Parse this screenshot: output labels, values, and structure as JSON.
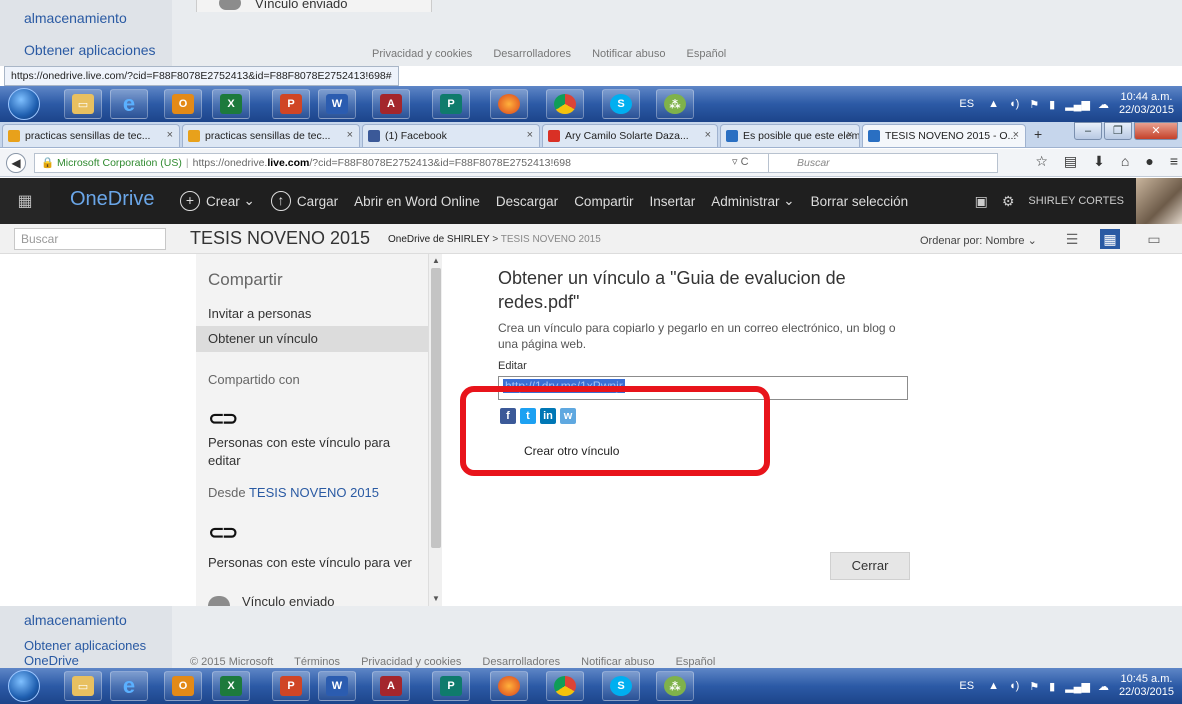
{
  "bg_top": {
    "sidebar_links": [
      "almacenamiento",
      "Obtener aplicaciones"
    ],
    "panel_item": "Vínculo enviado",
    "footer": [
      "Privacidad y cookies",
      "Desarrolladores",
      "Notificar abuso",
      "Español"
    ]
  },
  "status_url": "https://onedrive.live.com/?cid=F88F8078E2752413&id=F88F8078E2752413!698#",
  "taskbar_top": {
    "language": "ES",
    "time": "10:44 a.m.",
    "date": "22/03/2015",
    "apps": [
      "windows-explorer",
      "internet-explorer",
      "outlook",
      "excel",
      "powerpoint",
      "word",
      "access",
      "publisher",
      "firefox",
      "chrome",
      "skype",
      "network"
    ]
  },
  "browser": {
    "tabs": [
      {
        "label": "practicas sensillas de tec...",
        "color": "#e8a11b"
      },
      {
        "label": "practicas sensillas de tec...",
        "color": "#e8a11b"
      },
      {
        "label": "(1) Facebook",
        "color": "#3b5998"
      },
      {
        "label": "Ary Camilo Solarte Daza...",
        "color": "#d93025"
      },
      {
        "label": "Es posible que este elem...",
        "color": "#2a6fc2"
      },
      {
        "label": "TESIS NOVENO 2015 - O...",
        "color": "#2a6fc2"
      }
    ],
    "url_identity": "Microsoft Corporation (US)",
    "url_prefix": "https://onedrive.",
    "url_domain": "live.com",
    "url_rest": "/?cid=F88F8078E2752413&id=F88F8078E2752413!698",
    "search_placeholder": "Buscar"
  },
  "onedrive": {
    "brand": "OneDrive",
    "commands": [
      "Crear",
      "Cargar",
      "Abrir en Word Online",
      "Descargar",
      "Compartir",
      "Insertar",
      "Administrar",
      "Borrar selección"
    ],
    "user": "SHIRLEY CORTES",
    "search_placeholder": "Buscar",
    "folder_title": "TESIS NOVENO 2015",
    "crumb_root": "OneDrive de SHIRLEY",
    "crumb_sep": ">",
    "crumb_current": "TESIS NOVENO 2015",
    "order_label": "Ordenar por: Nombre"
  },
  "share_pane": {
    "title": "Compartir",
    "invite": "Invitar a personas",
    "get_link": "Obtener un vínculo",
    "shared_with": "Compartido con",
    "edit_people": "Personas con este vínculo para editar",
    "from_label": "Desde",
    "from_link": "TESIS NOVENO 2015",
    "view_people": "Personas con este vínculo para ver",
    "sent": "Vínculo enviado"
  },
  "dialog": {
    "title": "Obtener un vínculo a \"Guia de evalucion de redes.pdf\"",
    "description": "Crea un vínculo para copiarlo y pegarlo en un correo electrónico, un blog o una página web.",
    "edit_label": "Editar",
    "link_value": "http://1drv.ms/1xPwnjr",
    "create_other": "Crear otro vínculo",
    "close": "Cerrar"
  },
  "bg_bottom": {
    "sidebar_links": [
      "almacenamiento",
      "Obtener aplicaciones",
      "OneDrive"
    ],
    "footer": [
      "© 2015 Microsoft",
      "Términos",
      "Privacidad y cookies",
      "Desarrolladores",
      "Notificar abuso",
      "Español"
    ]
  },
  "taskbar_bottom": {
    "language": "ES",
    "time": "10:45 a.m.",
    "date": "22/03/2015"
  },
  "colors": {
    "highlight": "#e8141b",
    "onedrive_bar": "#1f1f1f",
    "accent": "#2a5aa3"
  }
}
